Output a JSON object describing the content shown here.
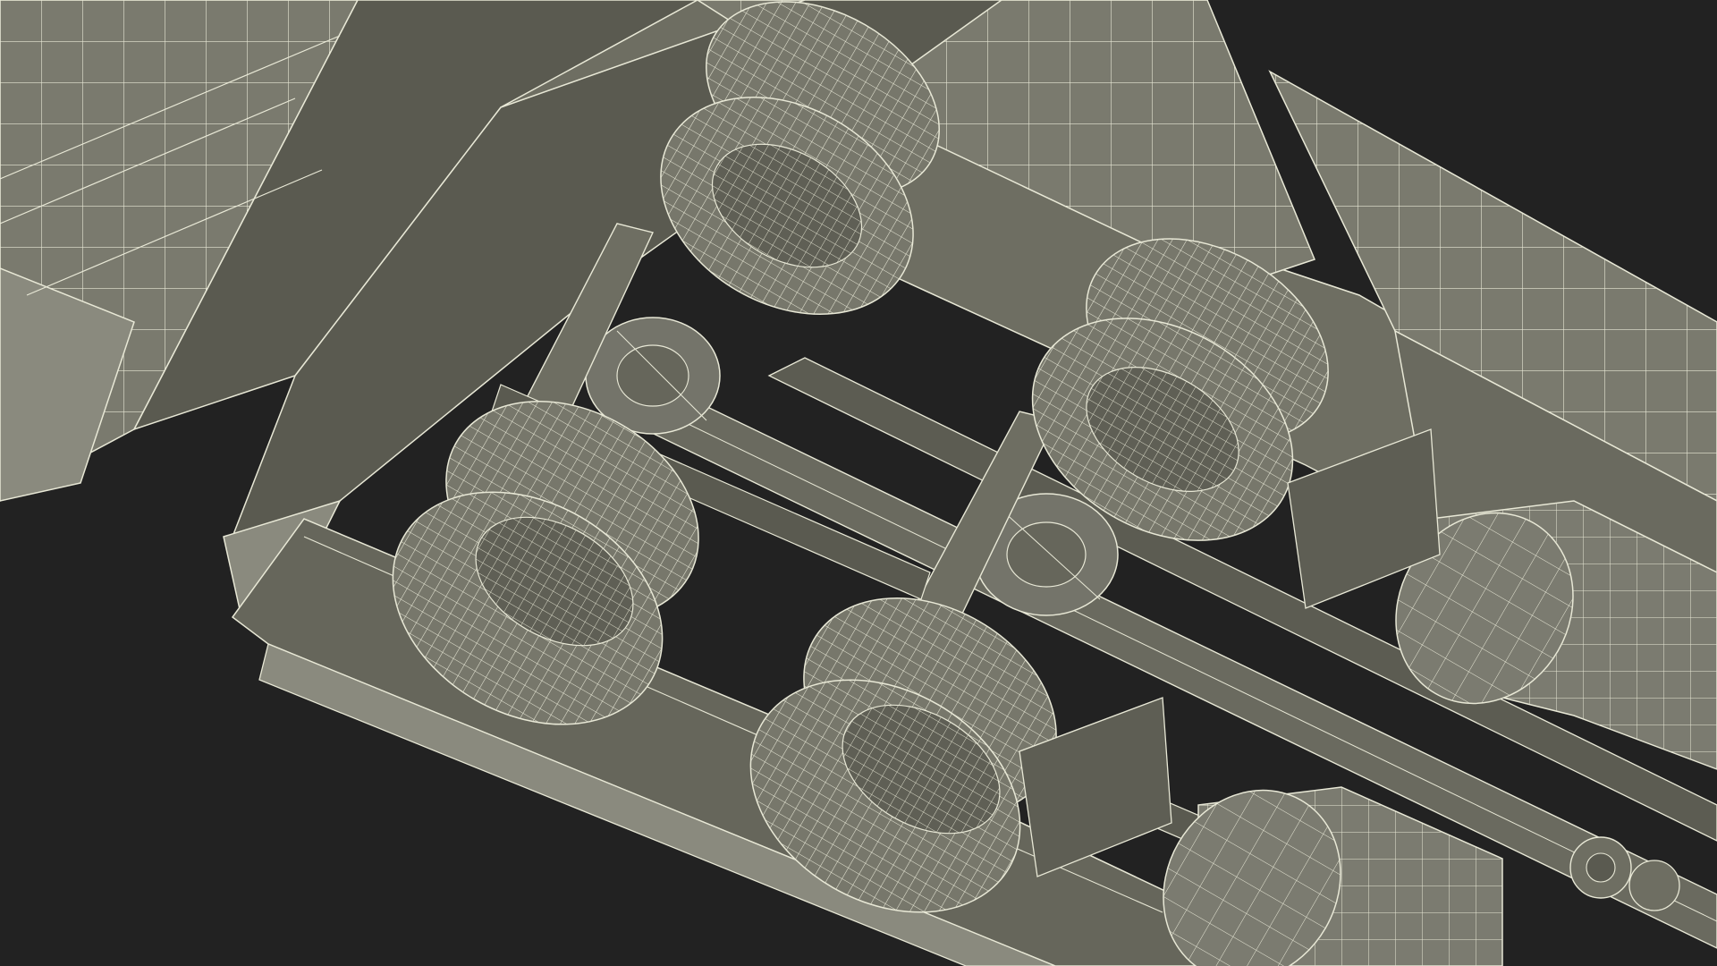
{
  "scene": {
    "subject": "truck-underside-wireframe",
    "colors": {
      "background": "#222222",
      "chassis_fill": "#6e6e62",
      "chassis_dark": "#4f4f46",
      "panel_light": "#85857a",
      "tire_fill": "#77776b",
      "tire_dark": "#5c5c52",
      "tank_fill": "#7b7b70",
      "wire": "#e8e8d6"
    },
    "wheel_count": 8,
    "fuel_tank_count": 2
  }
}
